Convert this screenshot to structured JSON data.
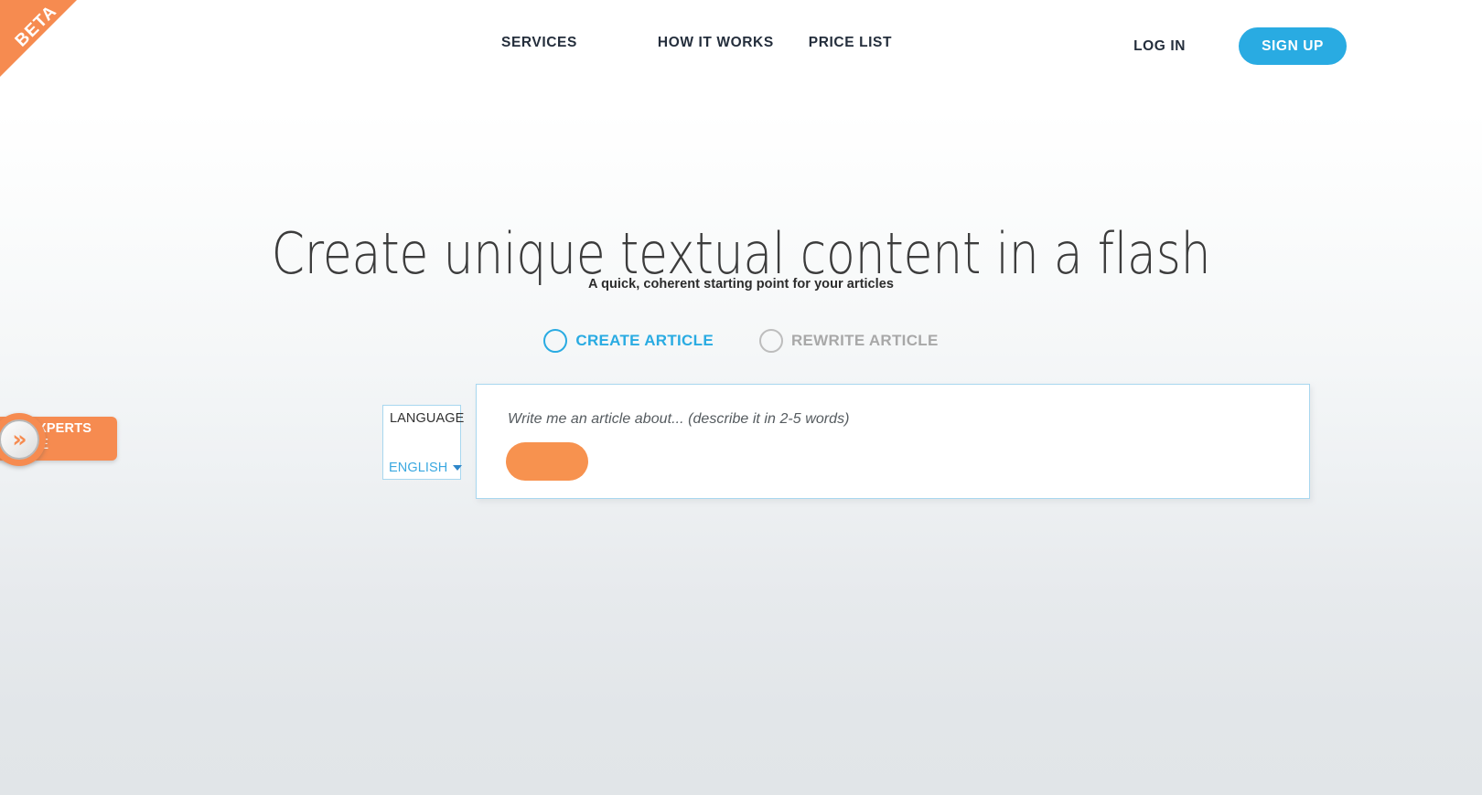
{
  "header": {
    "nav": [
      {
        "label": "SERVICES",
        "name": "nav-services"
      },
      {
        "label": "HOW IT WORKS",
        "name": "nav-how-it-works"
      },
      {
        "label": "PRICE LIST",
        "name": "nav-price-list"
      }
    ],
    "login_label": "LOG IN",
    "signup_label": "SIGN UP"
  },
  "ribbon": {
    "label": "BETA",
    "color": "#f68b50"
  },
  "hero": {
    "title": "Create unique textual content in a flash",
    "subtitle": "A quick, coherent starting point for your articles"
  },
  "mode_options": [
    {
      "label": "CREATE ARTICLE",
      "selected": true,
      "color": "#29abe2"
    },
    {
      "label": "REWRITE ARTICLE",
      "selected": false,
      "color": "#a8a8a8"
    }
  ],
  "language": {
    "label": "LANGUAGE",
    "value": "ENGLISH",
    "options": [
      "ENGLISH"
    ],
    "chevron_icon": "chevron-down-icon"
  },
  "form": {
    "placeholder": "Write me an article about... (describe it in 2-5 words)",
    "input_value": "",
    "submit_label": "",
    "submit_color": "#f7924f"
  },
  "side_widget": {
    "line1": "GENCIES & SEO EXPERTS",
    "line2": "CLICK HERE",
    "chevrons_icon": "double-chevron-right-icon",
    "chevrons_glyph": "»"
  },
  "colors": {
    "accent_blue": "#29abe2",
    "accent_orange": "#f68b50",
    "panel_border": "#a8d7ef",
    "text_dark": "#242e3c"
  }
}
